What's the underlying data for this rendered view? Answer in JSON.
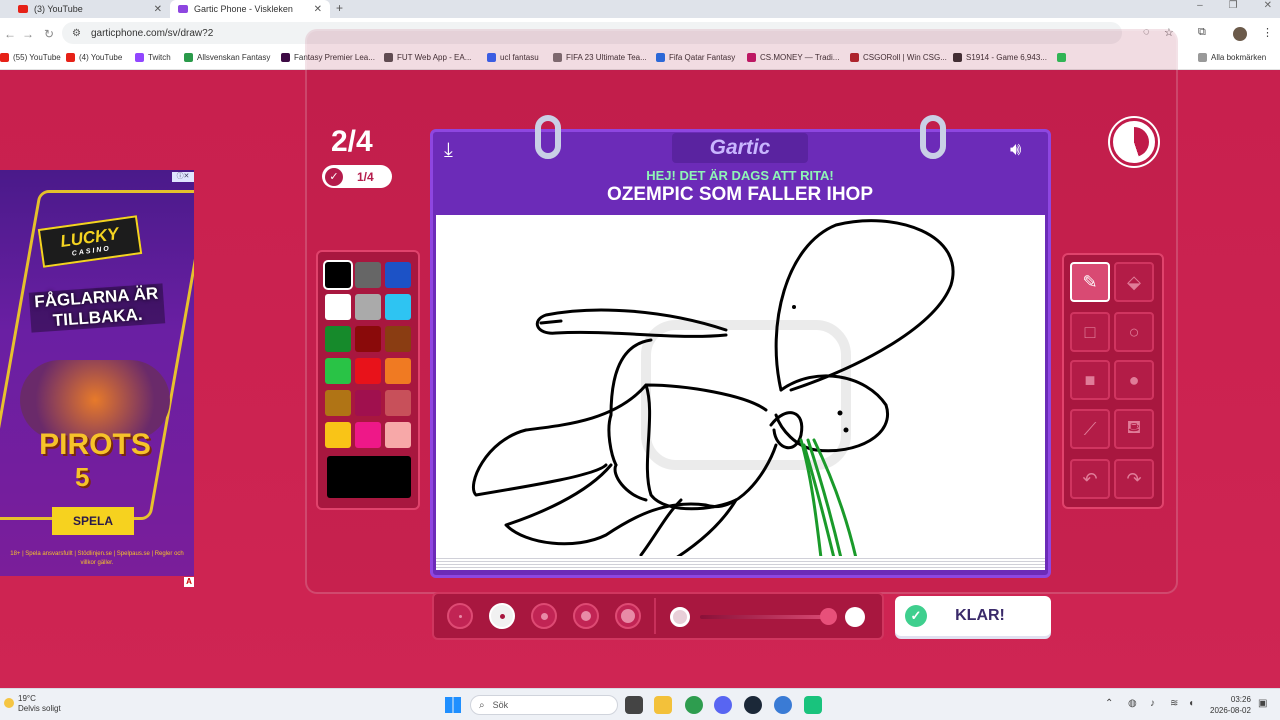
{
  "browser": {
    "tabs": [
      {
        "title": "(3) YouTube"
      },
      {
        "title": "Gartic Phone - Viskleken"
      }
    ],
    "url": "garticphone.com/sv/draw?2",
    "bookmarks": [
      "(55) YouTube",
      "(4) YouTube",
      "Twitch",
      "Allsvenskan Fantasy",
      "Fantasy Premier Lea...",
      "FUT Web App - EA...",
      "ucl fantasu",
      "FIFA 23 Ultimate Tea...",
      "Fifa Qatar Fantasy",
      "CS.MONEY — Tradi...",
      "CSGORoll | Win CSG...",
      "S1914 - Game 6,943..."
    ],
    "all_bookmarks": "Alla bokmärken"
  },
  "ad": {
    "brand": "LUCKY",
    "brand_sub": "CASINO",
    "headline": "FÅGLARNA ÄR TILLBAKA.",
    "game": "PIROTS",
    "game_num": "5",
    "cta": "SPELA",
    "legal": "18+ | Spela ansvarsfullt | Stödlinjen.se | Spelpaus.se | Regler och villkor gäller."
  },
  "game": {
    "round": "2/4",
    "done_count": "1/4",
    "brand": "Gartic",
    "prompt_intro": "HEJ! DET ÄR DAGS ATT RITA!",
    "prompt": "OZEMPIC SOM FALLER IHOP",
    "done_label": "KLAR!",
    "timer_fraction": 0.45,
    "colors": [
      "#000000",
      "#666666",
      "#1c52c6",
      "#ffffff",
      "#aaaaaa",
      "#2ec4f2",
      "#168a2b",
      "#8a0a0a",
      "#8a3d12",
      "#29c346",
      "#e8121a",
      "#f07a22",
      "#b07415",
      "#a0104e",
      "#c8505a",
      "#f9c417",
      "#ee1888",
      "#f7a8a8"
    ],
    "selected_color": "#000000",
    "tools": [
      "pencil-icon",
      "eraser-icon",
      "square-outline-icon",
      "circle-outline-icon",
      "square-filled-icon",
      "circle-filled-icon",
      "line-icon",
      "bucket-icon",
      "undo-icon",
      "redo-icon"
    ],
    "brush_sizes": 5,
    "selected_brush": 2,
    "opacity": 1.0
  },
  "taskbar": {
    "temp": "19°C",
    "weather": "Delvis soligt",
    "search": "Sök",
    "time": "03:26",
    "date": "2026-08-02"
  }
}
